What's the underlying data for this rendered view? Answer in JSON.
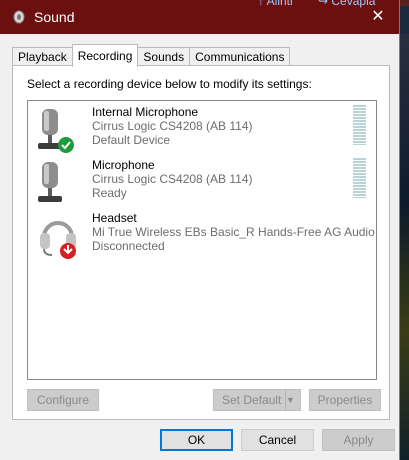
{
  "background": {
    "left_text": "↑ Alinti",
    "right_text": "↪ Cevapla"
  },
  "window": {
    "title": "Sound",
    "close_glyph": "✕"
  },
  "tabs": [
    {
      "label": "Playback",
      "active": false
    },
    {
      "label": "Recording",
      "active": true
    },
    {
      "label": "Sounds",
      "active": false
    },
    {
      "label": "Communications",
      "active": false
    }
  ],
  "instruction": "Select a recording device below to modify its settings:",
  "devices": [
    {
      "name": "Internal Microphone",
      "driver": "Cirrus Logic CS4208 (AB 114)",
      "status": "Default Device",
      "icon": "microphone-icon",
      "badge": "check-badge-icon"
    },
    {
      "name": "Microphone",
      "driver": "Cirrus Logic CS4208 (AB 114)",
      "status": "Ready",
      "icon": "microphone-icon",
      "badge": ""
    },
    {
      "name": "Headset",
      "driver": "Mi True Wireless EBs Basic_R Hands-Free AG Audio",
      "status": "Disconnected",
      "icon": "headset-icon",
      "badge": "disconnected-badge-icon"
    }
  ],
  "buttons": {
    "configure": "Configure",
    "set_default": "Set Default",
    "properties": "Properties",
    "ok": "OK",
    "cancel": "Cancel",
    "apply": "Apply"
  },
  "colors": {
    "titlebar": "#6b0f0f",
    "accent": "#0078d7",
    "check": "#1e9b3c",
    "disconnect": "#d42020"
  }
}
